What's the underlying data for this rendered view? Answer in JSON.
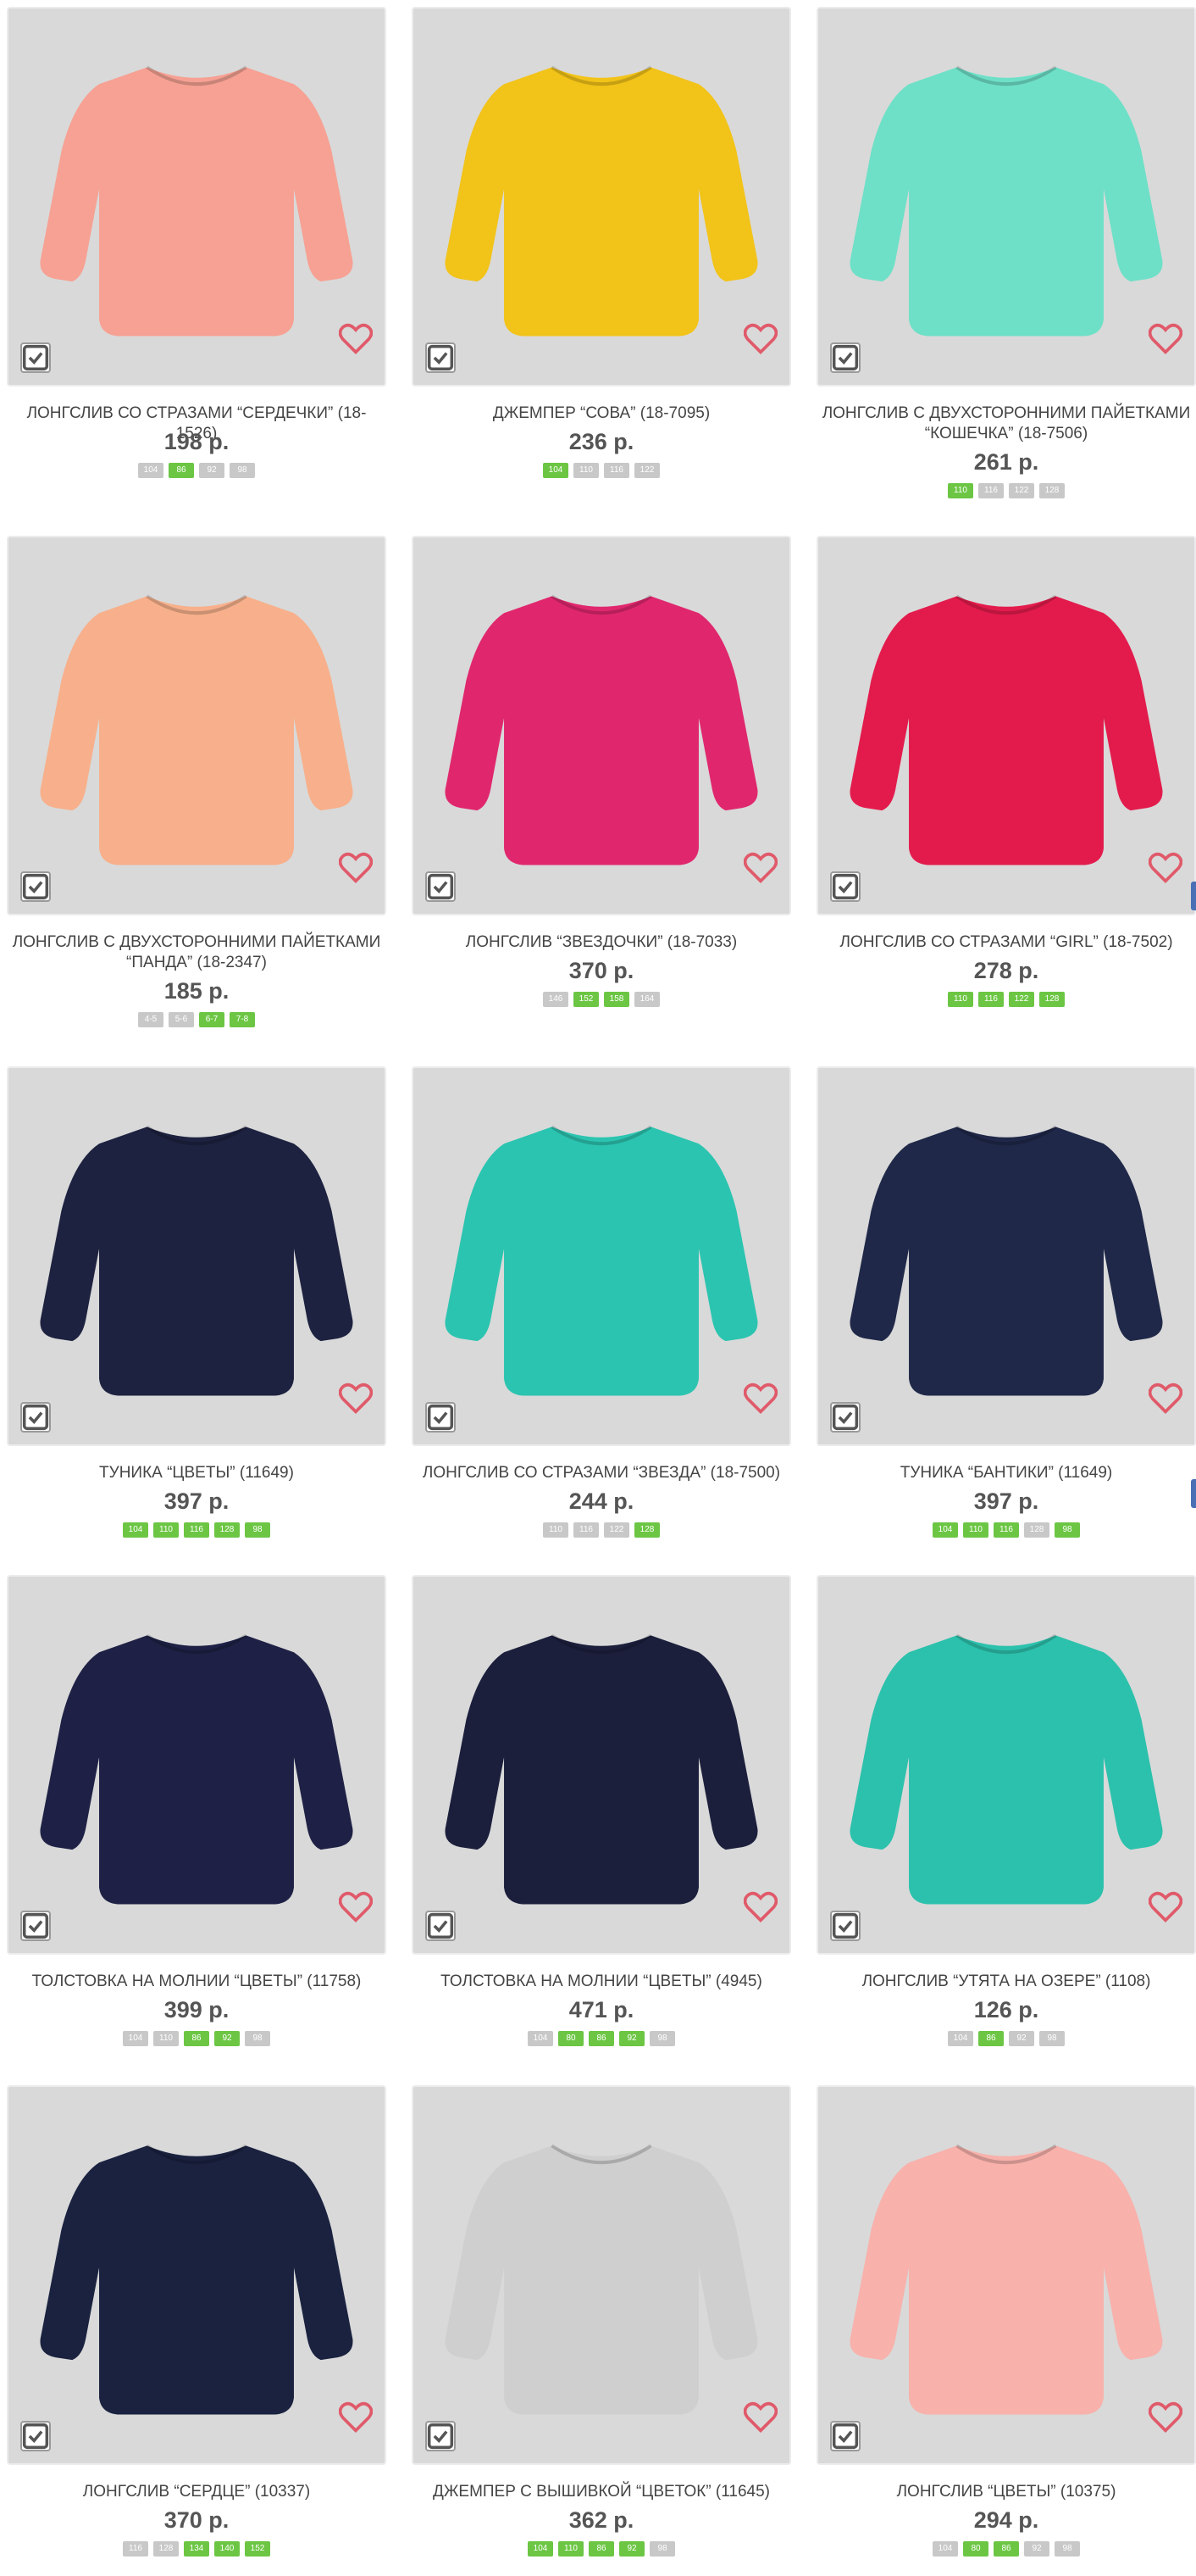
{
  "colors": {
    "available": "#6cc644",
    "unavailable": "#c8c8c8",
    "heart": "#e05a6a"
  },
  "products": [
    {
      "title": "ЛОНГСЛИВ СО СТРАЗАМИ “СЕРДЕЧКИ” (18-1526)",
      "price": "198 р.",
      "garment": "#f6a193",
      "sizes": [
        {
          "l": "104",
          "a": false
        },
        {
          "l": "86",
          "a": true
        },
        {
          "l": "92",
          "a": false
        },
        {
          "l": "98",
          "a": false
        }
      ]
    },
    {
      "title": "ДЖЕМПЕР “СОВА” (18-7095)",
      "price": "236 р.",
      "garment": "#f2c318",
      "sizes": [
        {
          "l": "104",
          "a": true
        },
        {
          "l": "110",
          "a": false
        },
        {
          "l": "116",
          "a": false
        },
        {
          "l": "122",
          "a": false
        }
      ]
    },
    {
      "title": "ЛОНГСЛИВ С ДВУХСТОРОННИМИ ПАЙЕТКАМИ “КОШЕЧКА” (18-7506)",
      "price": "261 р.",
      "garment": "#6ee0c7",
      "sizes": [
        {
          "l": "110",
          "a": true
        },
        {
          "l": "116",
          "a": false
        },
        {
          "l": "122",
          "a": false
        },
        {
          "l": "128",
          "a": false
        }
      ]
    },
    {
      "title": "ЛОНГСЛИВ С ДВУХСТОРОННИМИ ПАЙЕТКАМИ “ПАНДА” (18-2347)",
      "price": "185 р.",
      "garment": "#f7b08b",
      "sizes": [
        {
          "l": "4-5",
          "a": false
        },
        {
          "l": "5-6",
          "a": false
        },
        {
          "l": "6-7",
          "a": true
        },
        {
          "l": "7-8",
          "a": true
        }
      ]
    },
    {
      "title": "ЛОНГСЛИВ “ЗВЕЗДОЧКИ” (18-7033)",
      "price": "370 р.",
      "garment": "#e0276e",
      "sizes": [
        {
          "l": "146",
          "a": false
        },
        {
          "l": "152",
          "a": true
        },
        {
          "l": "158",
          "a": true
        },
        {
          "l": "164",
          "a": false
        }
      ]
    },
    {
      "title": "ЛОНГСЛИВ СО СТРАЗАМИ “GIRL” (18-7502)",
      "price": "278 р.",
      "garment": "#e31b4c",
      "sizes": [
        {
          "l": "110",
          "a": true
        },
        {
          "l": "116",
          "a": true
        },
        {
          "l": "122",
          "a": true
        },
        {
          "l": "128",
          "a": true
        }
      ]
    },
    {
      "title": "ТУНИКА “ЦВЕТЫ” (11649)",
      "price": "397 р.",
      "garment": "#1d2240",
      "sizes": [
        {
          "l": "104",
          "a": true
        },
        {
          "l": "110",
          "a": true
        },
        {
          "l": "116",
          "a": true
        },
        {
          "l": "128",
          "a": true
        },
        {
          "l": "98",
          "a": true
        }
      ]
    },
    {
      "title": "ЛОНГСЛИВ СО СТРАЗАМИ “ЗВЕЗДА” (18-7500)",
      "price": "244 р.",
      "garment": "#2bc4b0",
      "sizes": [
        {
          "l": "110",
          "a": false
        },
        {
          "l": "116",
          "a": false
        },
        {
          "l": "122",
          "a": false
        },
        {
          "l": "128",
          "a": true
        }
      ]
    },
    {
      "title": "ТУНИКА “БАНТИКИ” (11649)",
      "price": "397 р.",
      "garment": "#1f2848",
      "sizes": [
        {
          "l": "104",
          "a": true
        },
        {
          "l": "110",
          "a": true
        },
        {
          "l": "116",
          "a": true
        },
        {
          "l": "128",
          "a": false
        },
        {
          "l": "98",
          "a": true
        }
      ]
    },
    {
      "title": "ТОЛСТОВКА НА МОЛНИИ “ЦВЕТЫ” (11758)",
      "price": "399 р.",
      "garment": "#1e2145",
      "sizes": [
        {
          "l": "104",
          "a": false
        },
        {
          "l": "110",
          "a": false
        },
        {
          "l": "86",
          "a": true
        },
        {
          "l": "92",
          "a": true
        },
        {
          "l": "98",
          "a": false
        }
      ]
    },
    {
      "title": "ТОЛСТОВКА НА МОЛНИИ “ЦВЕТЫ” (4945)",
      "price": "471 р.",
      "garment": "#1b1f3c",
      "sizes": [
        {
          "l": "104",
          "a": false
        },
        {
          "l": "80",
          "a": true
        },
        {
          "l": "86",
          "a": true
        },
        {
          "l": "92",
          "a": true
        },
        {
          "l": "98",
          "a": false
        }
      ]
    },
    {
      "title": "ЛОНГСЛИВ “УТЯТА НА ОЗЕРЕ” (1108)",
      "price": "126 р.",
      "garment": "#2cc1ac",
      "sizes": [
        {
          "l": "104",
          "a": false
        },
        {
          "l": "86",
          "a": true
        },
        {
          "l": "92",
          "a": false
        },
        {
          "l": "98",
          "a": false
        }
      ]
    },
    {
      "title": "ЛОНГСЛИВ “СЕРДЦЕ” (10337)",
      "price": "370 р.",
      "garment": "#1a2240",
      "sizes": [
        {
          "l": "116",
          "a": false
        },
        {
          "l": "128",
          "a": false
        },
        {
          "l": "134",
          "a": true
        },
        {
          "l": "140",
          "a": true
        },
        {
          "l": "152",
          "a": true
        }
      ]
    },
    {
      "title": "ДЖЕМПЕР С ВЫШИВКОЙ “ЦВЕТОК” (11645)",
      "price": "362 р.",
      "garment": "#cfcfcf",
      "sizes": [
        {
          "l": "104",
          "a": true
        },
        {
          "l": "110",
          "a": true
        },
        {
          "l": "86",
          "a": true
        },
        {
          "l": "92",
          "a": true
        },
        {
          "l": "98",
          "a": false
        }
      ]
    },
    {
      "title": "ЛОНГСЛИВ “ЦВЕТЫ” (10375)",
      "price": "294 р.",
      "garment": "#f8b1ab",
      "sizes": [
        {
          "l": "104",
          "a": false
        },
        {
          "l": "80",
          "a": true
        },
        {
          "l": "86",
          "a": true
        },
        {
          "l": "92",
          "a": false
        },
        {
          "l": "98",
          "a": false
        }
      ]
    }
  ]
}
